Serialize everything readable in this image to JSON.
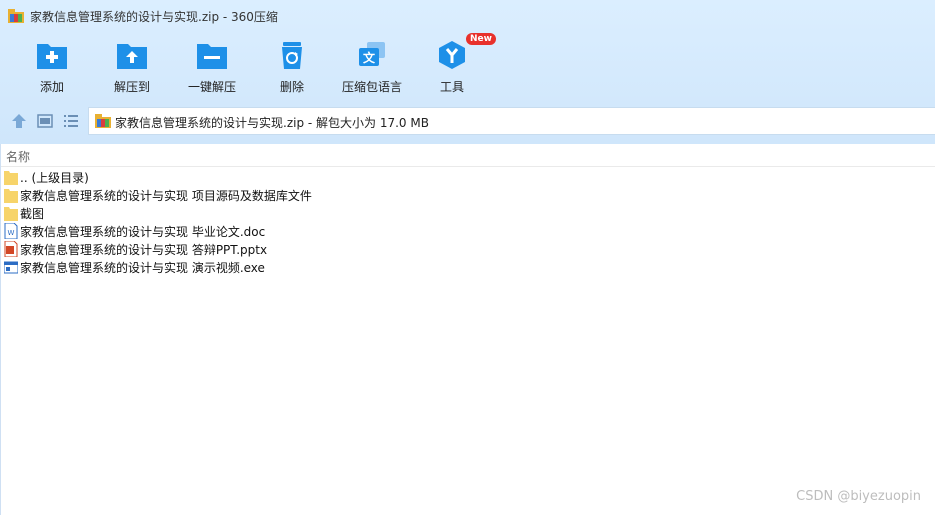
{
  "window": {
    "title": "家教信息管理系统的设计与实现.zip - 360压缩"
  },
  "toolbar": {
    "items": [
      {
        "label": "添加",
        "icon": "add-icon"
      },
      {
        "label": "解压到",
        "icon": "extract-to-icon"
      },
      {
        "label": "一键解压",
        "icon": "one-click-extract-icon"
      },
      {
        "label": "删除",
        "icon": "recycle-icon"
      },
      {
        "label": "压缩包语言",
        "icon": "language-icon"
      },
      {
        "label": "工具",
        "icon": "tools-icon",
        "badge": "New"
      }
    ]
  },
  "nav": {
    "up_icon": "up-arrow-icon",
    "view_icon": "thumbnail-view-icon",
    "list_icon": "list-view-icon",
    "address": "家教信息管理系统的设计与实现.zip - 解包大小为 17.0 MB"
  },
  "list": {
    "column_header": "名称",
    "files": [
      {
        "name": ".. (上级目录)",
        "icon": "folder-icon"
      },
      {
        "name": "家教信息管理系统的设计与实现 项目源码及数据库文件",
        "icon": "folder-icon"
      },
      {
        "name": "截图",
        "icon": "folder-icon"
      },
      {
        "name": "家教信息管理系统的设计与实现 毕业论文.doc",
        "icon": "word-doc-icon"
      },
      {
        "name": "家教信息管理系统的设计与实现 答辩PPT.pptx",
        "icon": "powerpoint-icon"
      },
      {
        "name": "家教信息管理系统的设计与实现 演示视频.exe",
        "icon": "exe-icon"
      }
    ]
  },
  "watermark": "CSDN @biyezuopin",
  "colors": {
    "accent": "#1e90e8",
    "toolbar_bg": "#d5eafd",
    "badge": "#e8312c"
  }
}
